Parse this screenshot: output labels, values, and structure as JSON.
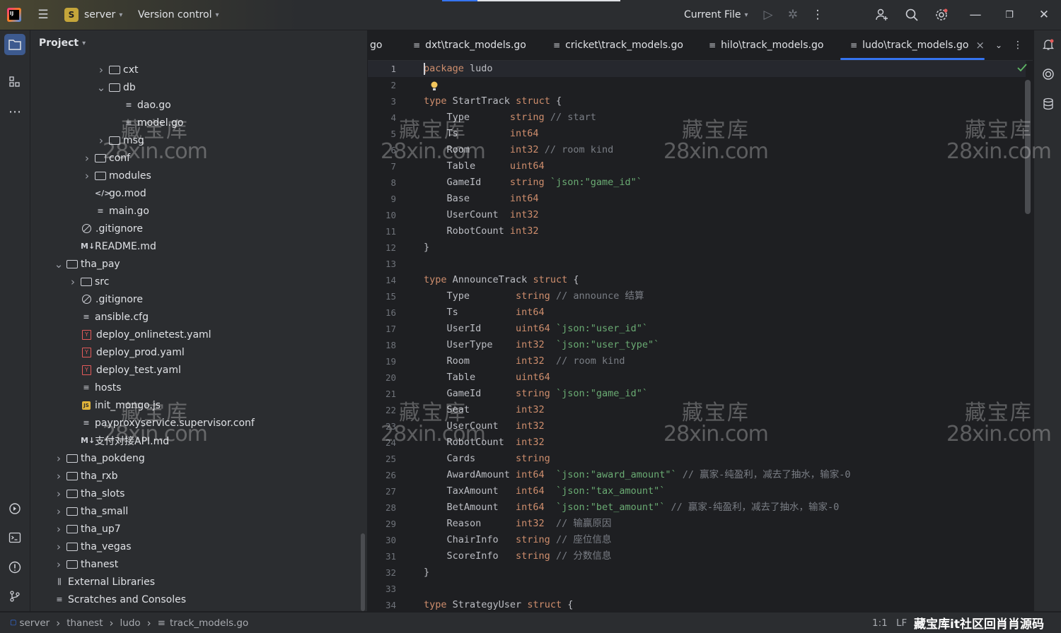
{
  "titlebar": {
    "project_badge": "S",
    "project_name": "server",
    "vcs": "Version control",
    "run_config": "Current File"
  },
  "project_panel": {
    "title": "Project",
    "tree": [
      {
        "label": "cxt",
        "kind": "folder",
        "expanded": false,
        "depth": 3
      },
      {
        "label": "db",
        "kind": "folder",
        "expanded": true,
        "depth": 3
      },
      {
        "label": "dao.go",
        "kind": "go",
        "depth": 4
      },
      {
        "label": "model.go",
        "kind": "go",
        "depth": 4
      },
      {
        "label": "msg",
        "kind": "folder",
        "expanded": false,
        "depth": 3
      },
      {
        "label": "conf",
        "kind": "folder",
        "expanded": false,
        "depth": 2
      },
      {
        "label": "modules",
        "kind": "folder",
        "expanded": false,
        "depth": 2
      },
      {
        "label": "go.mod",
        "kind": "mod",
        "depth": 2
      },
      {
        "label": "main.go",
        "kind": "go",
        "depth": 2
      },
      {
        "label": ".gitignore",
        "kind": "ignore",
        "depth": 1
      },
      {
        "label": "README.md",
        "kind": "md",
        "depth": 1
      },
      {
        "label": "tha_pay",
        "kind": "folder",
        "expanded": true,
        "depth": 0
      },
      {
        "label": "src",
        "kind": "folder",
        "expanded": false,
        "depth": 1
      },
      {
        "label": ".gitignore",
        "kind": "ignore",
        "depth": 1
      },
      {
        "label": "ansible.cfg",
        "kind": "text",
        "depth": 1
      },
      {
        "label": "deploy_onlinetest.yaml",
        "kind": "yaml",
        "depth": 1
      },
      {
        "label": "deploy_prod.yaml",
        "kind": "yaml",
        "depth": 1
      },
      {
        "label": "deploy_test.yaml",
        "kind": "yaml",
        "depth": 1
      },
      {
        "label": "hosts",
        "kind": "text",
        "depth": 1
      },
      {
        "label": "init_mongo.js",
        "kind": "js",
        "depth": 1
      },
      {
        "label": "payproxyservice.supervisor.conf",
        "kind": "text",
        "depth": 1
      },
      {
        "label": "支付对接API.md",
        "kind": "md",
        "depth": 1
      },
      {
        "label": "tha_pokdeng",
        "kind": "folder",
        "expanded": false,
        "depth": 0
      },
      {
        "label": "tha_rxb",
        "kind": "folder",
        "expanded": false,
        "depth": 0
      },
      {
        "label": "tha_slots",
        "kind": "folder",
        "expanded": false,
        "depth": 0
      },
      {
        "label": "tha_small",
        "kind": "folder",
        "expanded": false,
        "depth": 0
      },
      {
        "label": "tha_up7",
        "kind": "folder",
        "expanded": false,
        "depth": 0
      },
      {
        "label": "tha_vegas",
        "kind": "folder",
        "expanded": false,
        "depth": 0
      },
      {
        "label": "thanest",
        "kind": "folder",
        "expanded": false,
        "depth": 0
      },
      {
        "label": "External Libraries",
        "kind": "lib",
        "depth": -1
      },
      {
        "label": "Scratches and Consoles",
        "kind": "scratch",
        "depth": -1
      }
    ]
  },
  "tabs": [
    {
      "label": "go",
      "partial": true,
      "active": false
    },
    {
      "label": "dxt\\track_models.go",
      "active": false
    },
    {
      "label": "cricket\\track_models.go",
      "active": false
    },
    {
      "label": "hilo\\track_models.go",
      "active": false
    },
    {
      "label": "ludo\\track_models.go",
      "active": true
    }
  ],
  "code": [
    [
      [
        "k",
        "package"
      ],
      [
        "t",
        " ludo"
      ]
    ],
    [],
    [
      [
        "k",
        "type"
      ],
      [
        "t",
        " StartTrack "
      ],
      [
        "k",
        "struct"
      ],
      [
        "b",
        " {"
      ]
    ],
    [
      [
        "t",
        "    Type       "
      ],
      [
        "k",
        "string"
      ],
      [
        "c",
        " // start"
      ]
    ],
    [
      [
        "t",
        "    Ts         "
      ],
      [
        "k",
        "int64"
      ]
    ],
    [
      [
        "t",
        "    Room       "
      ],
      [
        "k",
        "int32"
      ],
      [
        "c",
        " // room kind"
      ]
    ],
    [
      [
        "t",
        "    Table      "
      ],
      [
        "k",
        "uint64"
      ]
    ],
    [
      [
        "t",
        "    GameId     "
      ],
      [
        "k",
        "string"
      ],
      [
        "s",
        " `json:\"game_id\"`"
      ]
    ],
    [
      [
        "t",
        "    Base       "
      ],
      [
        "k",
        "int64"
      ]
    ],
    [
      [
        "t",
        "    UserCount  "
      ],
      [
        "k",
        "int32"
      ]
    ],
    [
      [
        "t",
        "    RobotCount "
      ],
      [
        "k",
        "int32"
      ]
    ],
    [
      [
        "b",
        "}"
      ]
    ],
    [],
    [
      [
        "k",
        "type"
      ],
      [
        "t",
        " AnnounceTrack "
      ],
      [
        "k",
        "struct"
      ],
      [
        "b",
        " {"
      ]
    ],
    [
      [
        "t",
        "    Type        "
      ],
      [
        "k",
        "string"
      ],
      [
        "c",
        " // announce 结算"
      ]
    ],
    [
      [
        "t",
        "    Ts          "
      ],
      [
        "k",
        "int64"
      ]
    ],
    [
      [
        "t",
        "    UserId      "
      ],
      [
        "k",
        "uint64"
      ],
      [
        "s",
        " `json:\"user_id\"`"
      ]
    ],
    [
      [
        "t",
        "    UserType    "
      ],
      [
        "k",
        "int32 "
      ],
      [
        "s",
        " `json:\"user_type\"`"
      ]
    ],
    [
      [
        "t",
        "    Room        "
      ],
      [
        "k",
        "int32 "
      ],
      [
        "c",
        " // room kind"
      ]
    ],
    [
      [
        "t",
        "    Table       "
      ],
      [
        "k",
        "uint64"
      ]
    ],
    [
      [
        "t",
        "    GameId      "
      ],
      [
        "k",
        "string"
      ],
      [
        "s",
        " `json:\"game_id\"`"
      ]
    ],
    [
      [
        "t",
        "    Seat        "
      ],
      [
        "k",
        "int32"
      ]
    ],
    [
      [
        "t",
        "    UserCount   "
      ],
      [
        "k",
        "int32"
      ]
    ],
    [
      [
        "t",
        "    RobotCount  "
      ],
      [
        "k",
        "int32"
      ]
    ],
    [
      [
        "t",
        "    Cards       "
      ],
      [
        "k",
        "string"
      ]
    ],
    [
      [
        "t",
        "    AwardAmount "
      ],
      [
        "k",
        "int64 "
      ],
      [
        "s",
        " `json:\"award_amount\"`"
      ],
      [
        "c",
        " // 赢家-纯盈利，减去了抽水，输家-0"
      ]
    ],
    [
      [
        "t",
        "    TaxAmount   "
      ],
      [
        "k",
        "int64 "
      ],
      [
        "s",
        " `json:\"tax_amount\"`"
      ]
    ],
    [
      [
        "t",
        "    BetAmount   "
      ],
      [
        "k",
        "int64 "
      ],
      [
        "s",
        " `json:\"bet_amount\"`"
      ],
      [
        "c",
        " // 赢家-纯盈利，减去了抽水，输家-0"
      ]
    ],
    [
      [
        "t",
        "    Reason      "
      ],
      [
        "k",
        "int32 "
      ],
      [
        "c",
        " // 输赢原因"
      ]
    ],
    [
      [
        "t",
        "    ChairInfo   "
      ],
      [
        "k",
        "string"
      ],
      [
        "c",
        " // 座位信息"
      ]
    ],
    [
      [
        "t",
        "    ScoreInfo   "
      ],
      [
        "k",
        "string"
      ],
      [
        "c",
        " // 分数信息"
      ]
    ],
    [
      [
        "b",
        "}"
      ]
    ],
    [],
    [
      [
        "k",
        "type"
      ],
      [
        "t",
        " StrategyUser "
      ],
      [
        "k",
        "struct"
      ],
      [
        "b",
        " {"
      ]
    ]
  ],
  "status": {
    "breadcrumb": [
      "server",
      "thanest",
      "ludo",
      "track_models.go"
    ],
    "position": "1:1",
    "line_sep": "LF",
    "banner": "藏宝库it社区回肖肖源码"
  },
  "watermark": {
    "line1": "藏宝库",
    "line2": "28xin.com"
  },
  "colors": {
    "accent": "#3574f0",
    "keyword": "#cf8e6d",
    "string": "#6aab73",
    "comment": "#7a7e85"
  }
}
